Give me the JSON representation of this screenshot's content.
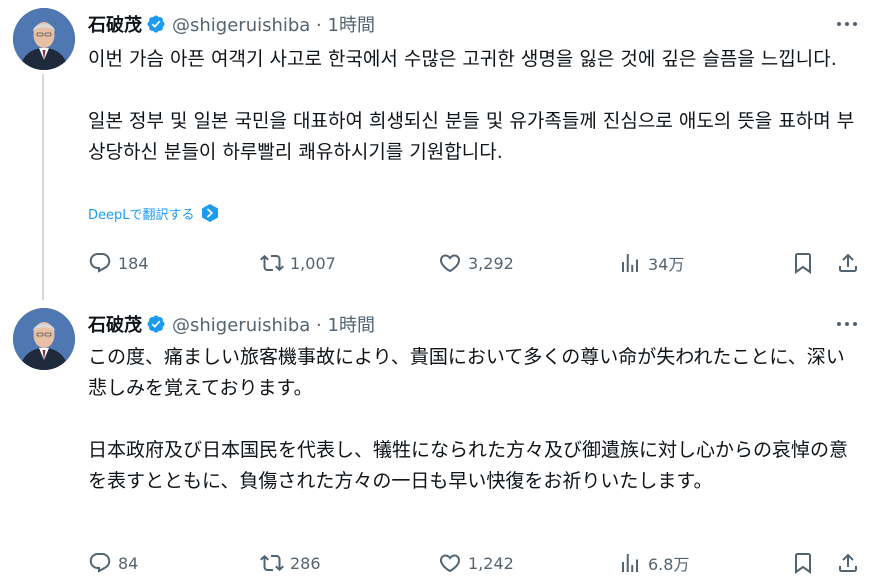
{
  "accent_color": "#1d9bf0",
  "tweets": [
    {
      "author": "石破茂",
      "handle_time": "@shigeruishiba · 1時間",
      "paragraphs": [
        "이번 가슴 아픈 여객기 사고로 한국에서 수많은 고귀한 생명을 잃은 것에 깊은 슬픔을 느낍니다.",
        "일본 정부 및 일본 국민을 대표하여 희생되신 분들 및 유가족들께 진심으로 애도의 뜻을 표하며 부상당하신 분들이 하루빨리 쾌유하시기를 기원합니다."
      ],
      "translate_label": "DeepLで翻訳する",
      "replies": "184",
      "reposts": "1,007",
      "likes": "3,292",
      "views": "34万"
    },
    {
      "author": "石破茂",
      "handle_time": "@shigeruishiba · 1時間",
      "paragraphs": [
        "この度、痛ましい旅客機事故により、貴国において多くの尊い命が失われたことに、深い悲しみを覚えております。",
        "日本政府及び日本国民を代表し、犠牲になられた方々及び御遺族に対し心からの哀悼の意を表すとともに、負傷された方々の一日も早い快復をお祈りいたします。"
      ],
      "replies": "84",
      "reposts": "286",
      "likes": "1,242",
      "views": "6.8万"
    }
  ]
}
